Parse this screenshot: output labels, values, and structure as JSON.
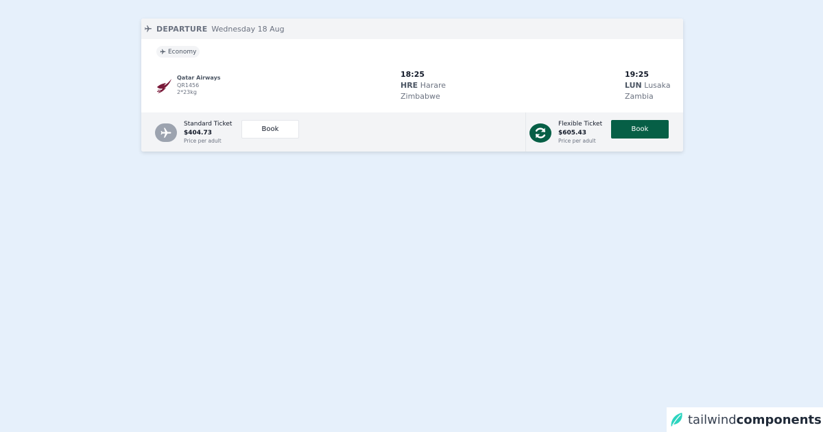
{
  "header": {
    "label": "DEPARTURE",
    "date": "Wednesday 18 Aug",
    "icon": "plane-icon"
  },
  "flight": {
    "cabin_class": "Economy",
    "airline_name": "Qatar Airways",
    "flight_number": "QR1456",
    "baggage": "2*23kg",
    "departure": {
      "time": "18:25",
      "code": "HRE",
      "city": "Harare",
      "country": "Zimbabwe"
    },
    "arrival": {
      "time": "19:25",
      "code": "LUN",
      "city": "Lusaka",
      "country": "Zambia"
    }
  },
  "tickets": {
    "standard": {
      "name": "Standard Ticket",
      "price": "$404.73",
      "note": "Price per adult",
      "button": "Book",
      "icon": "plane-icon"
    },
    "flexible": {
      "name": "Flexible Ticket",
      "price": "$605.43",
      "note": "Price per adult",
      "button": "Book",
      "icon": "refresh-icon"
    }
  },
  "brand": {
    "light": "tailwind",
    "bold": "components"
  },
  "colors": {
    "background": "#e6f0fb",
    "accent": "#065f46",
    "airline_brand": "#7a1a3a"
  }
}
